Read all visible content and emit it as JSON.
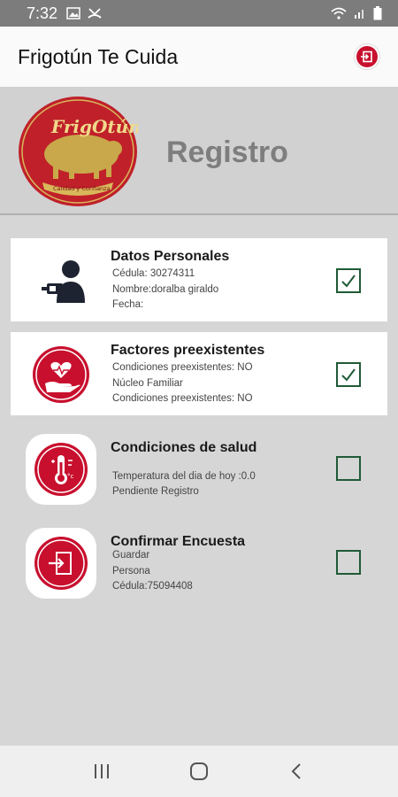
{
  "status_bar": {
    "time": "7:32"
  },
  "app_bar": {
    "title": "Frigotún Te Cuida"
  },
  "header": {
    "title": "Registro",
    "logo_text": "FrigOtún",
    "logo_tagline": "Calidad y Confianza"
  },
  "cards": [
    {
      "title": "Datos Personales",
      "lines": [
        "Cédula: 30274311",
        "Nombre:doralba giraldo",
        "Fecha:"
      ],
      "checked": true
    },
    {
      "title": "Factores preexistentes",
      "lines": [
        "Condiciones preexistentes: NO",
        "Núcleo Familiar",
        "Condiciones preexistentes: NO"
      ],
      "checked": true
    },
    {
      "title": "Condiciones de salud",
      "lines": [
        "Temperatura del dia de hoy :0.0",
        "Pendiente Registro"
      ],
      "checked": false
    },
    {
      "title": "Confirmar Encuesta",
      "lines": [
        "Guardar",
        "Persona",
        "Cédula:75094408"
      ],
      "checked": false
    }
  ],
  "colors": {
    "brand_red": "#c8102e",
    "check_green": "#1f5a36",
    "gold": "#c8a84a"
  }
}
